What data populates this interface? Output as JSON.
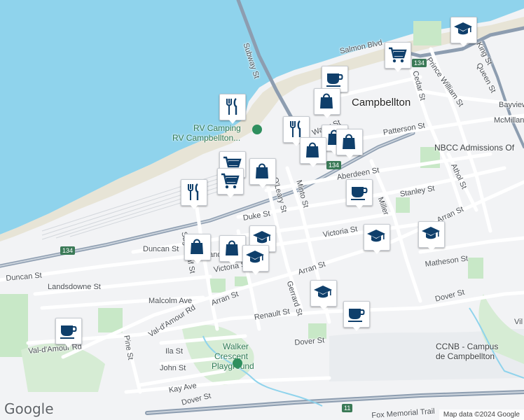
{
  "map": {
    "colors": {
      "water": "#8fd3ec",
      "land": "#f2f3f5",
      "road": "#ffffff",
      "highway": "#8d9db0",
      "park": "#c8e8c7",
      "marker_icon": "#0f3f6b"
    },
    "city_label": "Campbellton",
    "streets": [
      "Salmon Blvd",
      "Subway St",
      "King St",
      "Queen St",
      "Prince William St",
      "Cedar St",
      "Bayview",
      "McMillan",
      "Patterson St",
      "Water St",
      "Aberdeen St",
      "Stanley St",
      "O'Leary St",
      "Minto St",
      "Miller",
      "Duke St",
      "Victoria St",
      "Victoria St",
      "Duncan St",
      "Duncan St",
      "Landsdowne St",
      "Landsdowne",
      "Sugarloaf St",
      "Arran St",
      "Arran St",
      "Arran St",
      "Matheson St",
      "Malcolm Ave",
      "Gerrard St",
      "Renault St",
      "Dover St",
      "Dover St",
      "Dover St",
      "Val-d'Amour Rd",
      "Val-d'Amour Rd",
      "Ila St",
      "John St",
      "Pine St",
      "Kay Ave",
      "Athol St",
      "Fox Memorial Trail",
      "Vil"
    ],
    "route_shields": [
      "134",
      "134",
      "134",
      "11"
    ],
    "places": {
      "rv_camping_1": "RV Camping",
      "rv_camping_2": "RV Campbellton...",
      "nbcc": "NBCC Admissions Of",
      "ccnb_1": "CCNB - Campus",
      "ccnb_2": "de Campbellton",
      "walker_1": "Walker",
      "walker_2": "Crescent",
      "walker_3": "Playground"
    },
    "markers": [
      {
        "icon": "school-icon"
      },
      {
        "icon": "grocery-cart-icon"
      },
      {
        "icon": "coffee-cup-icon"
      },
      {
        "icon": "shopping-bag-icon"
      },
      {
        "icon": "restaurant-icon"
      },
      {
        "icon": "restaurant-icon"
      },
      {
        "icon": "shopping-bag-icon"
      },
      {
        "icon": "shopping-bag-icon"
      },
      {
        "icon": "shopping-bag-icon"
      },
      {
        "icon": "grocery-cart-icon"
      },
      {
        "icon": "shopping-bag-icon"
      },
      {
        "icon": "grocery-cart-icon"
      },
      {
        "icon": "restaurant-icon"
      },
      {
        "icon": "coffee-cup-icon"
      },
      {
        "icon": "shopping-bag-icon"
      },
      {
        "icon": "shopping-bag-icon"
      },
      {
        "icon": "school-icon"
      },
      {
        "icon": "school-icon"
      },
      {
        "icon": "school-icon"
      },
      {
        "icon": "school-icon"
      },
      {
        "icon": "school-icon"
      },
      {
        "icon": "coffee-cup-icon"
      },
      {
        "icon": "coffee-cup-icon"
      }
    ],
    "logo": "Google",
    "attribution": "Map data ©2024 Google"
  }
}
